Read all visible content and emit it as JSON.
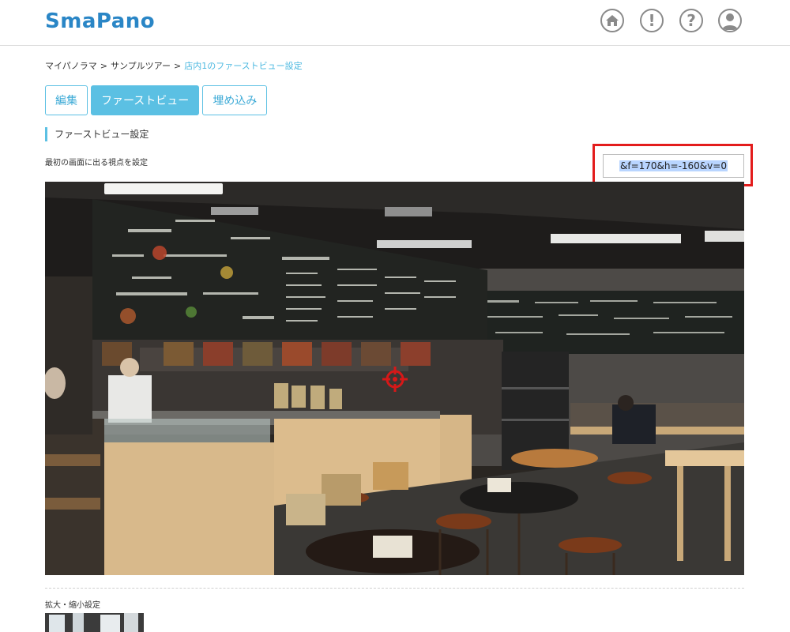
{
  "header": {
    "logo": "SmaPano",
    "icons": [
      "home-icon",
      "alert-icon",
      "help-icon",
      "user-icon"
    ],
    "alert_glyph": "!",
    "help_glyph": "?"
  },
  "breadcrumb": {
    "items": [
      "マイパノラマ",
      "サンプルツアー"
    ],
    "separator": ">",
    "current": "店内1のファーストビュー設定"
  },
  "tabs": [
    {
      "label": "編集",
      "active": false
    },
    {
      "label": "ファーストビュー",
      "active": true
    },
    {
      "label": "埋め込み",
      "active": false
    }
  ],
  "section": {
    "title": "ファーストビュー設定",
    "description": "最初の画面に出る視点を設定"
  },
  "param": {
    "value": "&f=170&h=-160&v=0",
    "highlight_color": "#e31c1c"
  },
  "zoom": {
    "label": "拡大・縮小設定"
  },
  "colors": {
    "accent": "#5bc0e3",
    "logo": "#2a86c6",
    "link": "#4bb8e0"
  }
}
